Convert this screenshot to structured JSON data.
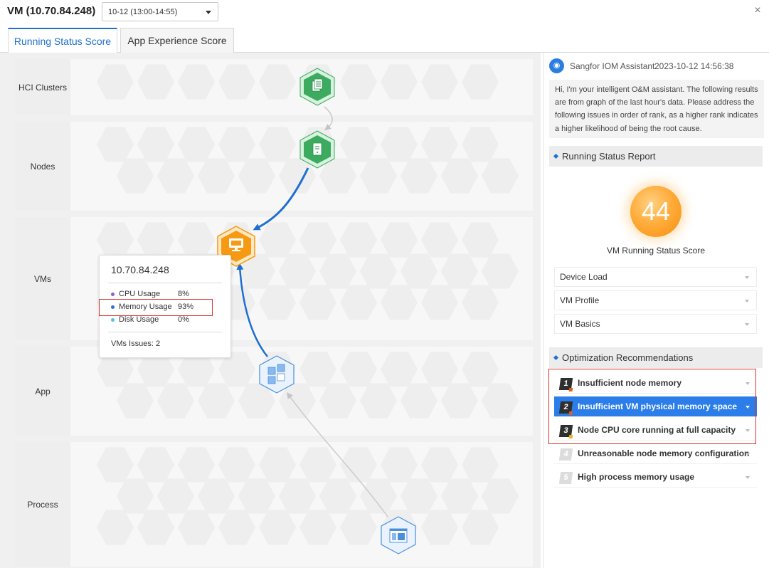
{
  "header": {
    "title": "VM (10.70.84.248)",
    "time_range": "10-12 (13:00-14:55)",
    "close_label": "×"
  },
  "tabs": [
    {
      "label": "Running Status Score",
      "active": true
    },
    {
      "label": "App Experience Score",
      "active": false
    }
  ],
  "lanes": [
    {
      "label": "HCI Clusters"
    },
    {
      "label": "Nodes"
    },
    {
      "label": "VMs"
    },
    {
      "label": "App"
    },
    {
      "label": "Process"
    }
  ],
  "graph_nodes": [
    {
      "name": "hci-cluster-node",
      "icon": "cluster-icon",
      "color": "#3cab5f"
    },
    {
      "name": "host-node",
      "icon": "server-icon",
      "color": "#3cab5f"
    },
    {
      "name": "vm-node",
      "icon": "monitor-icon",
      "color": "#f59a12"
    },
    {
      "name": "app-node",
      "icon": "app-grid-icon",
      "color": "#4a90d9"
    },
    {
      "name": "process-node",
      "icon": "process-window-icon",
      "color": "#4a90d9"
    }
  ],
  "tooltip": {
    "title": "10.70.84.248",
    "metrics": [
      {
        "label": "CPU Usage",
        "value": "8%",
        "color": "#8e5bd3"
      },
      {
        "label": "Memory Usage",
        "value": "93%",
        "color": "#2f6fd8"
      },
      {
        "label": "Disk Usage",
        "value": "0%",
        "color": "#4fc2e0"
      }
    ],
    "issues": "VMs Issues: 2"
  },
  "assistant": {
    "name": "Sangfor IOM Assistant",
    "timestamp": "2023-10-12 14:56:38",
    "message": "Hi, I'm your intelligent O&M assistant. The following results are from graph of the last hour's data. Please address the following issues in order of rank, as a higher rank indicates a higher likelihood of being the root cause."
  },
  "report": {
    "title": "Running Status Report",
    "score": "44",
    "score_label": "VM Running Status Score",
    "sections": [
      "Device Load",
      "VM Profile",
      "VM Basics"
    ]
  },
  "recommendations": {
    "title": "Optimization Recommendations",
    "items": [
      {
        "rank": "1",
        "label": "Insufficient node memory",
        "selected": false,
        "flagged": true
      },
      {
        "rank": "2",
        "label": "Insufficient VM physical memory space",
        "selected": true,
        "flagged": true
      },
      {
        "rank": "3",
        "label": "Node CPU core running at full capacity",
        "selected": false,
        "flagged": true
      },
      {
        "rank": "4",
        "label": "Unreasonable node memory configuration",
        "selected": false,
        "flagged": false
      },
      {
        "rank": "5",
        "label": "High process memory usage",
        "selected": false,
        "flagged": false
      }
    ]
  }
}
